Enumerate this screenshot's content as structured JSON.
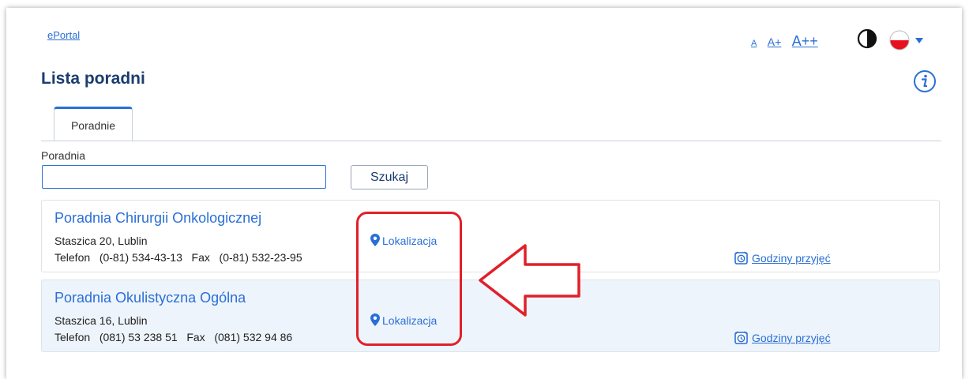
{
  "header": {
    "breadcrumb": "ePortal",
    "title": "Lista poradni",
    "font_sizes": [
      "A",
      "A+",
      "A++"
    ],
    "icons": {
      "contrast": "contrast-icon",
      "language": "poland-flag-icon",
      "info": "info-icon"
    }
  },
  "tabs": [
    {
      "label": "Poradnie"
    }
  ],
  "search": {
    "label": "Poradnia",
    "value": "",
    "button_label": "Szukaj"
  },
  "clinics": [
    {
      "name": "Poradnia Chirurgii Onkologicznej",
      "address": "Staszica 20, Lublin",
      "phone_line": "Telefon   (0-81) 534-43-13   Fax   (0-81) 532-23-95",
      "location_label": "Lokalizacja",
      "hours_label": "Godziny przyjęć"
    },
    {
      "name": "Poradnia Okulistyczna Ogólna",
      "address": "Staszica 16, Lublin",
      "phone_line": "Telefon   (081) 53 238 51   Fax   (081) 532 94 86",
      "location_label": "Lokalizacja",
      "hours_label": "Godziny przyjęć"
    }
  ],
  "colors": {
    "accent": "#2a6fd6",
    "title": "#1b3c6e",
    "annotation": "#e0202a",
    "row_alt": "#eef4fb"
  }
}
